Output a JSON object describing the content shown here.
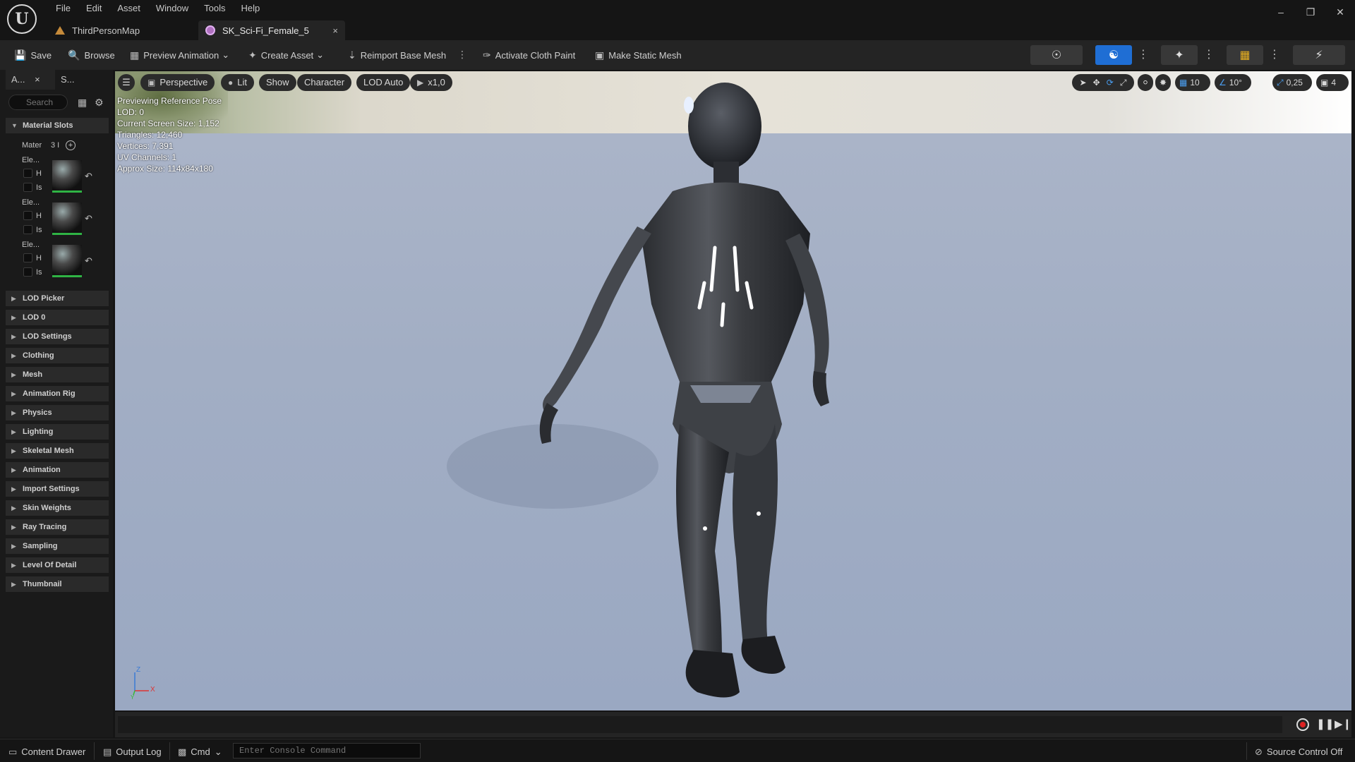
{
  "app": {
    "logo_text": "U",
    "menu": [
      "File",
      "Edit",
      "Asset",
      "Window",
      "Tools",
      "Help"
    ],
    "window_controls": {
      "minimize": "–",
      "restore": "❐",
      "close": "✕"
    }
  },
  "tabs": [
    {
      "label": "ThirdPersonMap",
      "active": false
    },
    {
      "label": "SK_Sci-Fi_Female_5",
      "active": true,
      "close": "×"
    }
  ],
  "toolbar": {
    "save": "Save",
    "browse": "Browse",
    "preview_animation": "Preview Animation",
    "create_asset": "Create Asset",
    "reimport": "Reimport Base Mesh",
    "cloth_paint": "Activate Cloth Paint",
    "static_mesh": "Make Static Mesh",
    "more": "⋮",
    "dropdown": "⌄"
  },
  "left_panel": {
    "tabs": [
      "A...",
      "S..."
    ],
    "tab_close": "×",
    "search_placeholder": "Search",
    "material_slots": {
      "header": "Material Slots",
      "label": "Mater",
      "count": "3 I",
      "elements": [
        {
          "label": "Ele...",
          "h": "H",
          "is": "Is"
        },
        {
          "label": "Ele...",
          "h": "H",
          "is": "Is"
        },
        {
          "label": "Ele...",
          "h": "H",
          "is": "Is"
        }
      ]
    },
    "sections": [
      "LOD Picker",
      "LOD 0",
      "LOD Settings",
      "Clothing",
      "Mesh",
      "Animation Rig",
      "Physics",
      "Lighting",
      "Skeletal Mesh",
      "Animation",
      "Import Settings",
      "Skin Weights",
      "Ray Tracing",
      "Sampling",
      "Level Of Detail",
      "Thumbnail"
    ]
  },
  "viewport": {
    "pills": {
      "perspective": "Perspective",
      "lit": "Lit",
      "show": "Show",
      "character": "Character",
      "lod": "LOD Auto",
      "speed": "x1,0"
    },
    "stats": [
      "Previewing Reference Pose",
      "LOD: 0",
      "Current Screen Size: 1,152",
      "Triangles: 12,460",
      "Vertices: 7,391",
      "UV Channels: 1",
      "Approx Size: 114x84x180"
    ],
    "right_controls": {
      "grid": "10",
      "angle": "10°",
      "scale": "0,25",
      "camera": "4"
    },
    "axis": {
      "z": "Z",
      "x": "X",
      "y": "Y"
    }
  },
  "statusbar": {
    "content_drawer": "Content Drawer",
    "output_log": "Output Log",
    "cmd": "Cmd",
    "console_placeholder": "Enter Console Command",
    "source_control": "Source Control Off"
  },
  "colors": {
    "accent": "#1f6ed4",
    "record": "#d22222",
    "material_ok": "#2fb344"
  }
}
